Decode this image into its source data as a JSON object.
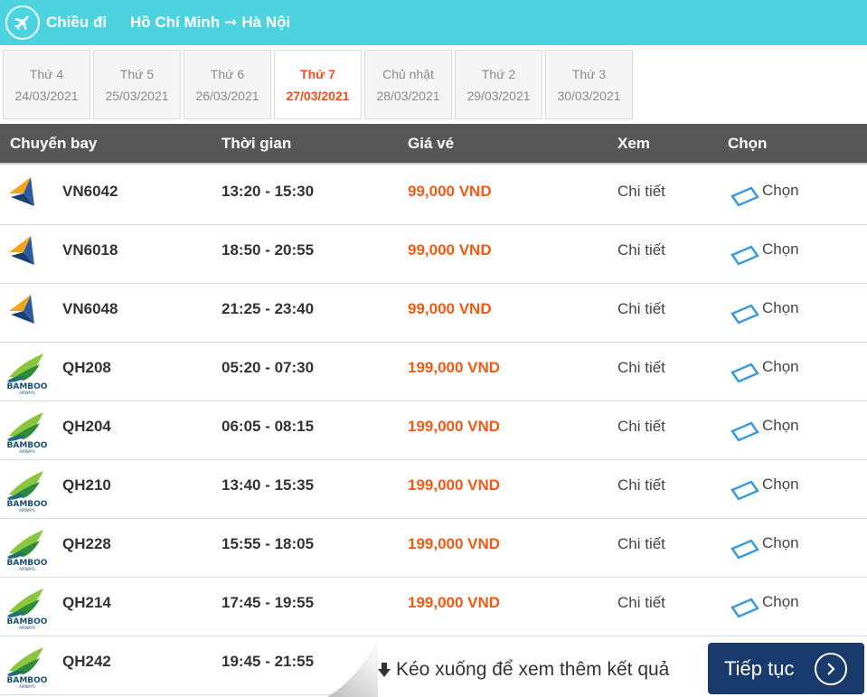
{
  "header": {
    "direction_label": "Chiều đi",
    "origin": "Hồ Chí Minh",
    "destination": "Hà Nội",
    "route_arrow": "➞"
  },
  "date_tabs": [
    {
      "day": "Thứ 4",
      "date": "24/03/2021",
      "active": false
    },
    {
      "day": "Thứ 5",
      "date": "25/03/2021",
      "active": false
    },
    {
      "day": "Thứ 6",
      "date": "26/03/2021",
      "active": false
    },
    {
      "day": "Thứ 7",
      "date": "27/03/2021",
      "active": true
    },
    {
      "day": "Chủ nhật",
      "date": "28/03/2021",
      "active": false
    },
    {
      "day": "Thứ 2",
      "date": "29/03/2021",
      "active": false
    },
    {
      "day": "Thứ 3",
      "date": "30/03/2021",
      "active": false
    }
  ],
  "table": {
    "headers": {
      "flight": "Chuyến bay",
      "time": "Thời gian",
      "price": "Giá vé",
      "view": "Xem",
      "choose": "Chọn"
    },
    "rows": [
      {
        "airline": "vietnam-airlines",
        "flight_no": "VN6042",
        "time": "13:20 - 15:30",
        "price": "99,000 VND",
        "detail": "Chi tiết",
        "choose": "Chọn"
      },
      {
        "airline": "vietnam-airlines",
        "flight_no": "VN6018",
        "time": "18:50 - 20:55",
        "price": "99,000 VND",
        "detail": "Chi tiết",
        "choose": "Chọn"
      },
      {
        "airline": "vietnam-airlines",
        "flight_no": "VN6048",
        "time": "21:25 - 23:40",
        "price": "99,000 VND",
        "detail": "Chi tiết",
        "choose": "Chọn"
      },
      {
        "airline": "bamboo",
        "flight_no": "QH208",
        "time": "05:20 - 07:30",
        "price": "199,000 VND",
        "detail": "Chi tiết",
        "choose": "Chọn"
      },
      {
        "airline": "bamboo",
        "flight_no": "QH204",
        "time": "06:05 - 08:15",
        "price": "199,000 VND",
        "detail": "Chi tiết",
        "choose": "Chọn"
      },
      {
        "airline": "bamboo",
        "flight_no": "QH210",
        "time": "13:40 - 15:35",
        "price": "199,000 VND",
        "detail": "Chi tiết",
        "choose": "Chọn"
      },
      {
        "airline": "bamboo",
        "flight_no": "QH228",
        "time": "15:55 - 18:05",
        "price": "199,000 VND",
        "detail": "Chi tiết",
        "choose": "Chọn"
      },
      {
        "airline": "bamboo",
        "flight_no": "QH214",
        "time": "17:45 - 19:55",
        "price": "199,000 VND",
        "detail": "Chi tiết",
        "choose": "Chọn"
      },
      {
        "airline": "bamboo",
        "flight_no": "QH242",
        "time": "19:45 - 21:55",
        "price": "",
        "detail": "",
        "choose": ""
      }
    ]
  },
  "footer": {
    "scroll_hint": "Kéo xuống để xem thêm kết quả",
    "continue_label": "Tiếp tục"
  },
  "logo_text": {
    "bamboo": "BAMBOO",
    "bamboo_sub": "AIRWAYS"
  },
  "colors": {
    "header_bg": "#4dd3df",
    "active_date": "#f04e1c",
    "price": "#f05a13",
    "table_head_bg": "#575757",
    "continue_btn_bg": "#183a6c",
    "radio_icon": "#3a9ad9"
  }
}
